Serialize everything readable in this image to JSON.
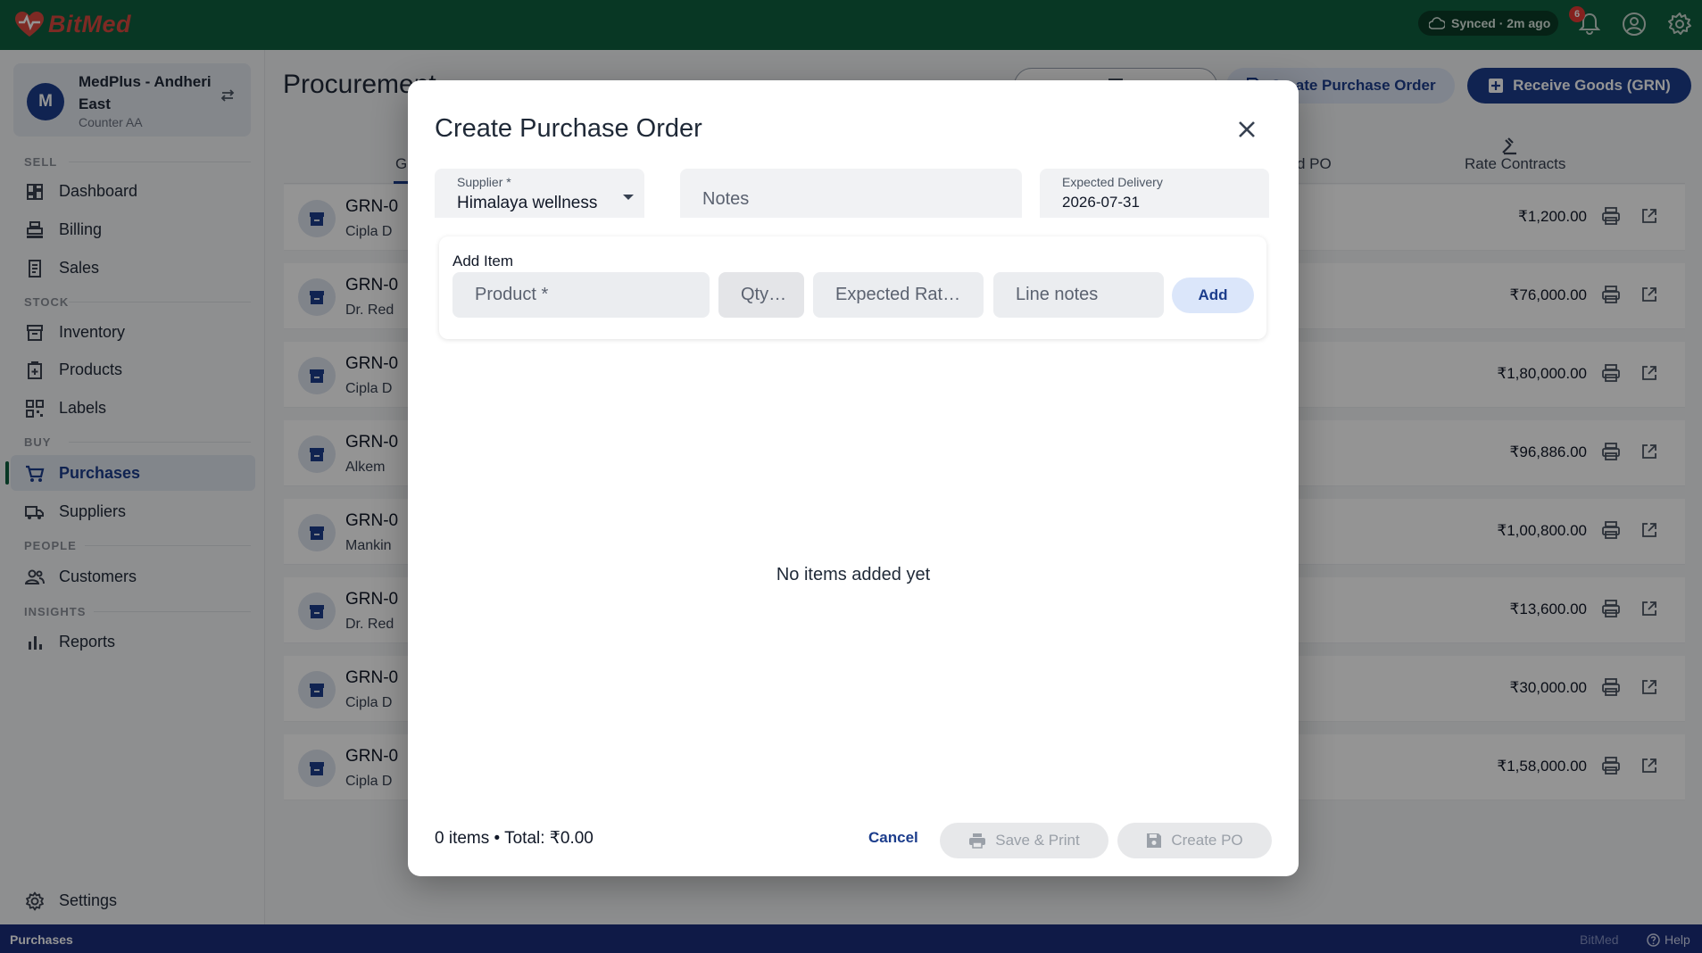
{
  "app": {
    "name": "BitMed",
    "accent": "#0f5f3e",
    "brand_color": "#d9493f"
  },
  "topbar": {
    "sync_status": "Synced · 2m ago",
    "notifications_count": "6"
  },
  "store": {
    "avatar_letter": "M",
    "name": "MedPlus - Andheri East",
    "counter": "Counter AA"
  },
  "sidebar": {
    "sections": {
      "sell": "SELL",
      "stock": "STOCK",
      "buy": "BUY",
      "people": "PEOPLE",
      "insights": "INSIGHTS"
    },
    "items": {
      "dashboard": "Dashboard",
      "billing": "Billing",
      "sales": "Sales",
      "inventory": "Inventory",
      "products": "Products",
      "labels": "Labels",
      "purchases": "Purchases",
      "suppliers": "Suppliers",
      "customers": "Customers",
      "reports": "Reports",
      "settings": "Settings"
    }
  },
  "page": {
    "title": "Procurement",
    "buttons": {
      "create_po": "Create Purchase Order",
      "receive_goods": "Receive Goods (GRN)"
    },
    "tabs": {
      "first_partial": "G",
      "po_partial": "d PO",
      "rate_contracts": "Rate Contracts"
    },
    "rows": [
      {
        "id": "GRN-0",
        "sub": "Cipla D",
        "amount": "₹1,200.00"
      },
      {
        "id": "GRN-0",
        "sub": "Dr. Red",
        "amount": "₹76,000.00"
      },
      {
        "id": "GRN-0",
        "sub": "Cipla D",
        "amount": "₹1,80,000.00"
      },
      {
        "id": "GRN-0",
        "sub": "Alkem",
        "amount": "₹96,886.00"
      },
      {
        "id": "GRN-0",
        "sub": "Mankin",
        "amount": "₹1,00,800.00"
      },
      {
        "id": "GRN-0",
        "sub": "Dr. Red",
        "amount": "₹13,600.00"
      },
      {
        "id": "GRN-0",
        "sub": "Cipla D",
        "amount": "₹30,000.00"
      },
      {
        "id": "GRN-0",
        "sub": "Cipla D",
        "amount": "₹1,58,000.00"
      }
    ]
  },
  "modal": {
    "title": "Create Purchase Order",
    "supplier": {
      "label": "Supplier *",
      "value": "Himalaya wellness"
    },
    "notes": {
      "placeholder": "Notes"
    },
    "delivery": {
      "label": "Expected Delivery",
      "value": "2026-07-31"
    },
    "add_item": {
      "title": "Add Item",
      "product_placeholder": "Product *",
      "qty_placeholder": "Qty…",
      "rate_placeholder": "Expected Rat…",
      "line_notes_placeholder": "Line notes",
      "add_label": "Add"
    },
    "empty_message": "No items added yet",
    "summary": "0 items • Total: ₹0.00",
    "cancel_label": "Cancel",
    "save_print_label": "Save & Print",
    "create_label": "Create PO"
  },
  "statusbar": {
    "section": "Purchases",
    "brand": "BitMed",
    "help": "Help"
  }
}
